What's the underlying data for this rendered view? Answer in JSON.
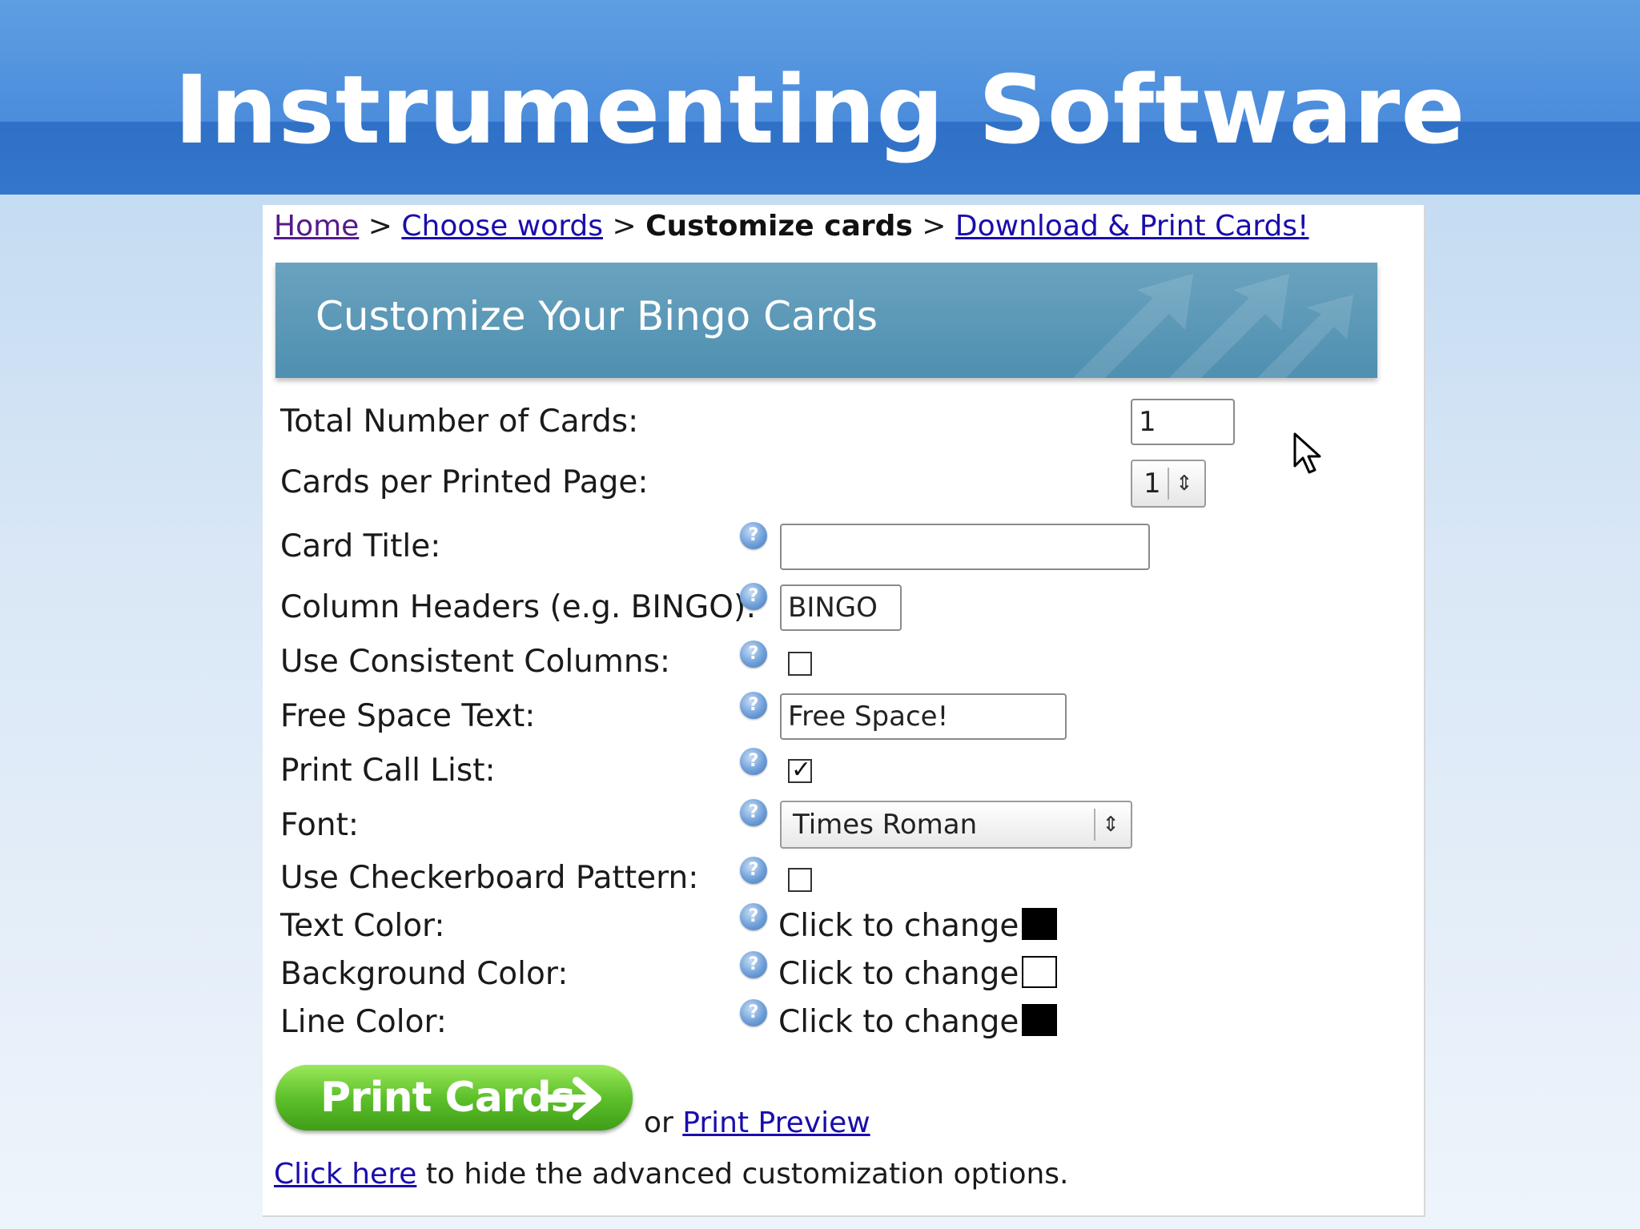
{
  "slide": {
    "title": "Instrumenting Software"
  },
  "breadcrumb": {
    "home": "Home",
    "sep": ">",
    "choose_words": "Choose words",
    "current": "Customize cards",
    "download": "Download & Print Cards!"
  },
  "banner": {
    "title": "Customize Your Bingo Cards"
  },
  "form": {
    "total_cards": {
      "label": "Total Number of Cards:",
      "value": "1"
    },
    "cards_per_page": {
      "label": "Cards per Printed Page:",
      "value": "1"
    },
    "card_title": {
      "label": "Card Title:",
      "value": ""
    },
    "column_headers": {
      "label": "Column Headers (e.g. BINGO):",
      "value": "BINGO"
    },
    "consistent_columns": {
      "label": "Use Consistent Columns:",
      "checked": false
    },
    "free_space": {
      "label": "Free Space Text:",
      "value": "Free Space!"
    },
    "print_call_list": {
      "label": "Print Call List:",
      "checked": true
    },
    "font": {
      "label": "Font:",
      "value": "Times Roman"
    },
    "checkerboard": {
      "label": "Use Checkerboard Pattern:",
      "checked": false
    },
    "text_color": {
      "label": "Text Color:",
      "action": "Click to change:",
      "color": "#000000"
    },
    "background_color": {
      "label": "Background Color:",
      "action": "Click to change:",
      "color": "#ffffff"
    },
    "line_color": {
      "label": "Line Color:",
      "action": "Click to change:",
      "color": "#000000"
    }
  },
  "actions": {
    "print_button": "Print Cards",
    "or": "or",
    "print_preview": "Print Preview",
    "click_here": "Click here",
    "hide_text": "to hide the advanced customization options."
  },
  "icons": {
    "help": "help-icon",
    "pointer": "mouse-pointer-icon",
    "arrow": "arrow-right-icon"
  }
}
